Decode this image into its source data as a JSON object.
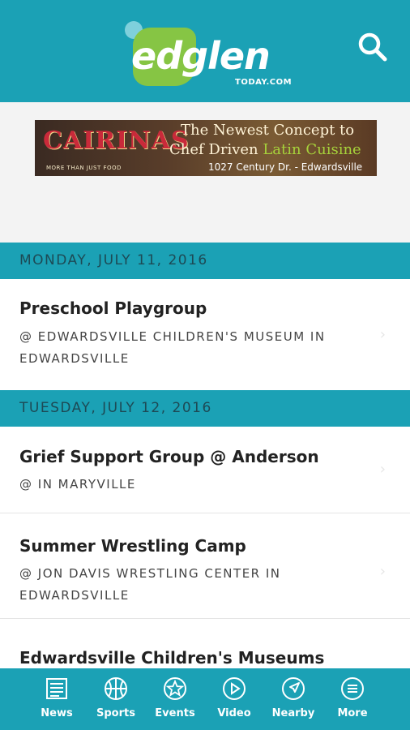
{
  "header": {
    "logo_text": "edglen",
    "logo_sub": "TODAY.COM",
    "search_icon": "search-icon",
    "brand_color": "#1ba1b5",
    "logo_green": "#86c544"
  },
  "ad": {
    "brand": "CAIRINAS",
    "tagline": "MORE THAN JUST FOOD",
    "line1": "The Newest Concept to",
    "line2_a": "Chef Driven ",
    "line2_b": "Latin Cuisine",
    "line3": "1027 Century Dr. - Edwardsville"
  },
  "days": [
    {
      "label": "MONDAY, JULY 11, 2016",
      "events": [
        {
          "title": "Preschool Playgroup",
          "location": "@ EDWARDSVILLE CHILDREN'S MUSEUM IN EDWARDSVILLE"
        }
      ]
    },
    {
      "label": "TUESDAY, JULY 12, 2016",
      "events": [
        {
          "title": "Grief Support Group @ Anderson",
          "location": "@ IN MARYVILLE"
        },
        {
          "title": "Summer Wrestling Camp",
          "location": "@ JON DAVIS WRESTLING CENTER IN EDWARDSVILLE"
        },
        {
          "title": "Edwardsville Children's Museums",
          "location": ""
        }
      ]
    }
  ],
  "tabs": [
    {
      "label": "News",
      "icon": "news-icon"
    },
    {
      "label": "Sports",
      "icon": "basketball-icon"
    },
    {
      "label": "Events",
      "icon": "star-icon"
    },
    {
      "label": "Video",
      "icon": "play-icon"
    },
    {
      "label": "Nearby",
      "icon": "navigation-arrow-icon"
    },
    {
      "label": "More",
      "icon": "menu-icon"
    }
  ]
}
